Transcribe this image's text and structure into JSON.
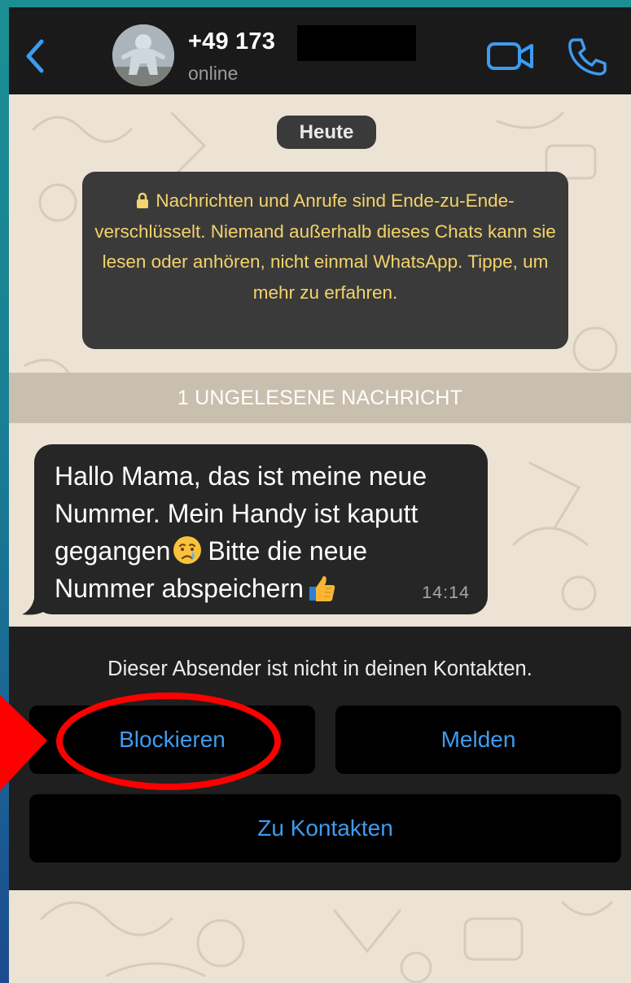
{
  "header": {
    "contact_name": "+49 173",
    "status": "online"
  },
  "chat": {
    "date_label": "Heute",
    "encryption_notice": "Nachrichten und Anrufe sind Ende-zu-Ende-verschlüsselt. Niemand außerhalb dieses Chats kann sie lesen oder anhören, nicht einmal WhatsApp. Tippe, um mehr zu erfahren.",
    "unread_banner": "1 UNGELESENE NACHRICHT",
    "message": {
      "line1": "Hallo Mama, das ist meine neue",
      "line2": "Nummer. Mein Handy ist kaputt",
      "line3_a": "gegangen",
      "line3_b": "Bitte die neue",
      "line4": "Nummer abspeichern",
      "time": "14:14"
    }
  },
  "sheet": {
    "info_text": "Dieser Absender ist nicht in deinen Kontakten.",
    "block_label": "Blockieren",
    "report_label": "Melden",
    "add_contact_label": "Zu Kontakten"
  },
  "colors": {
    "accent": "#3d9cf0",
    "encryption_text": "#f3d36b",
    "annotation": "#ff0000"
  },
  "icons": [
    "back-chevron-icon",
    "video-call-icon",
    "phone-icon",
    "lock-icon",
    "crying-emoji",
    "thumbs-up-emoji"
  ]
}
